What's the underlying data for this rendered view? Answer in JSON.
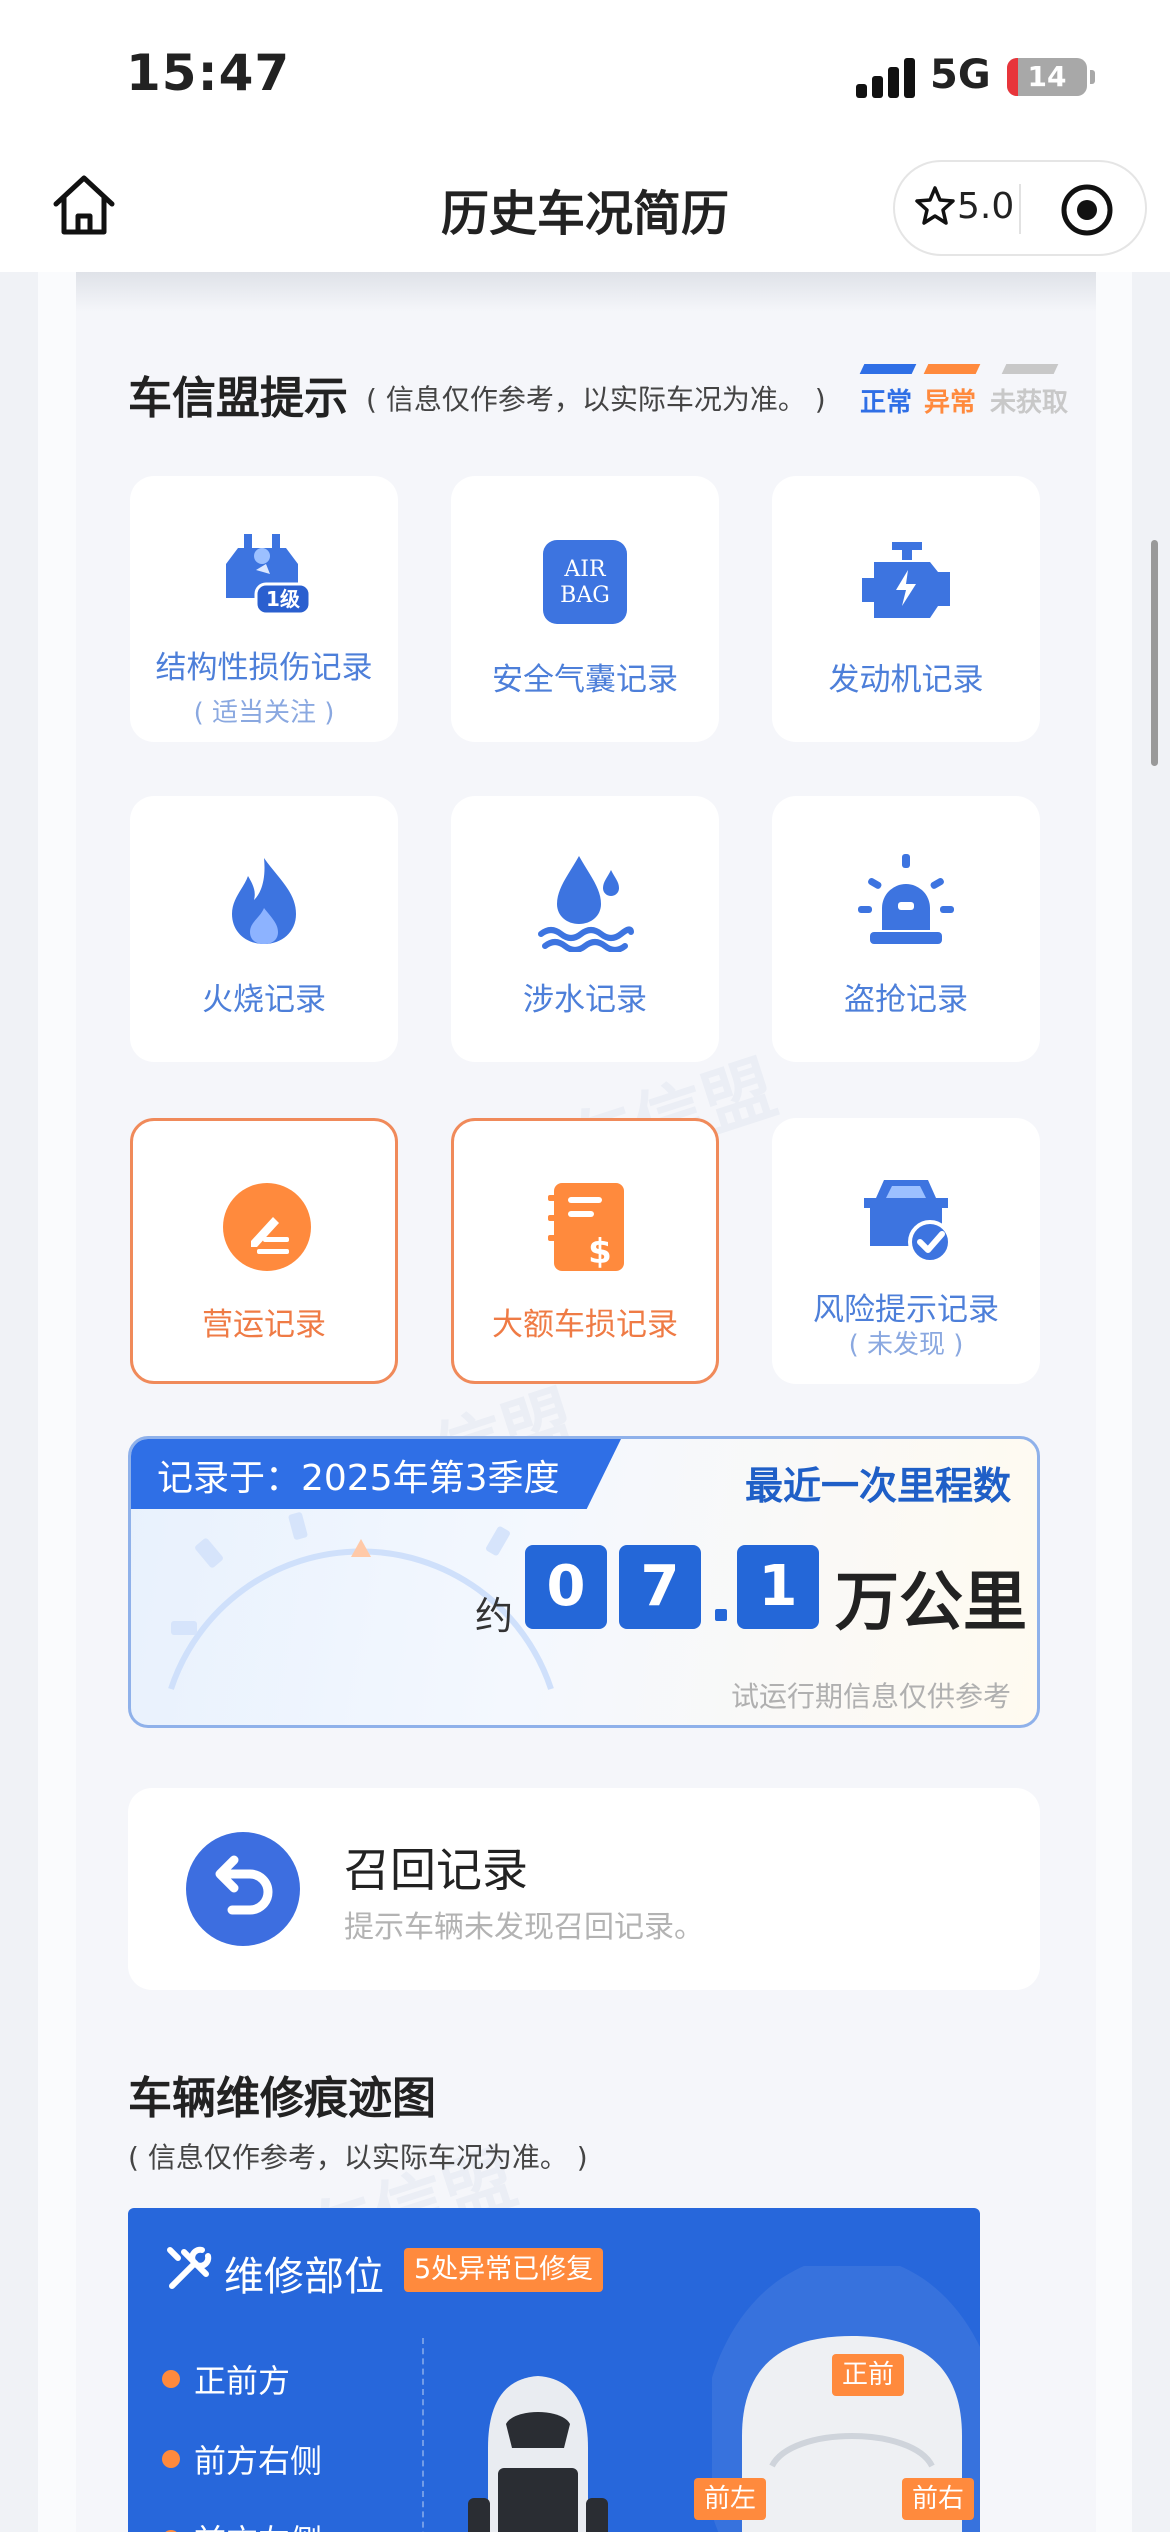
{
  "status_bar": {
    "time": "15:47",
    "network": "5G",
    "battery": "14",
    "battery_level": 0.14
  },
  "nav": {
    "title": "历史车况简历",
    "rating": "5.0"
  },
  "section1": {
    "title": "车信盟提示",
    "note": "( 信息仅作参考，以实际车况为准。 )",
    "legend": [
      {
        "label": "正常",
        "color": "#2f6fe6"
      },
      {
        "label": "异常",
        "color": "#ff8a3d"
      },
      {
        "label": "未获取",
        "color": "#c8c8c8"
      }
    ],
    "tiles": [
      {
        "label": "结构性损伤记录",
        "sub": "( 适当关注 )",
        "icon": "structural-damage-icon",
        "badge": "1级"
      },
      {
        "label": "安全气囊记录",
        "icon": "airbag-icon",
        "icon_text_1": "AIR",
        "icon_text_2": "BAG"
      },
      {
        "label": "发动机记录",
        "icon": "engine-icon"
      },
      {
        "label": "火烧记录",
        "icon": "fire-icon"
      },
      {
        "label": "涉水记录",
        "icon": "water-icon"
      },
      {
        "label": "盗抢记录",
        "icon": "alarm-icon"
      },
      {
        "label": "营运记录",
        "icon": "commercial-use-icon"
      },
      {
        "label": "大额车损记录",
        "icon": "major-damage-icon"
      },
      {
        "label": "风险提示记录",
        "sub": "( 未发现 )",
        "icon": "risk-check-icon"
      }
    ]
  },
  "mileage": {
    "tag": "记录于：2025年第3季度",
    "title": "最近一次里程数",
    "approx": "约",
    "digits": [
      "0",
      "7",
      "1"
    ],
    "unit": "万公里",
    "footnote": "试运行期信息仅供参考"
  },
  "recall": {
    "title": "召回记录",
    "desc": "提示车辆未发现召回记录。"
  },
  "section2": {
    "title": "车辆维修痕迹图",
    "note": "( 信息仅作参考，以实际车况为准。 )",
    "panel_title": "维修部位",
    "badge": "5处异常已修复",
    "parts": [
      "正前方",
      "前方右侧",
      "前方左侧"
    ],
    "tags": [
      "正前",
      "前左",
      "前右"
    ]
  },
  "watermark": "车信盟"
}
